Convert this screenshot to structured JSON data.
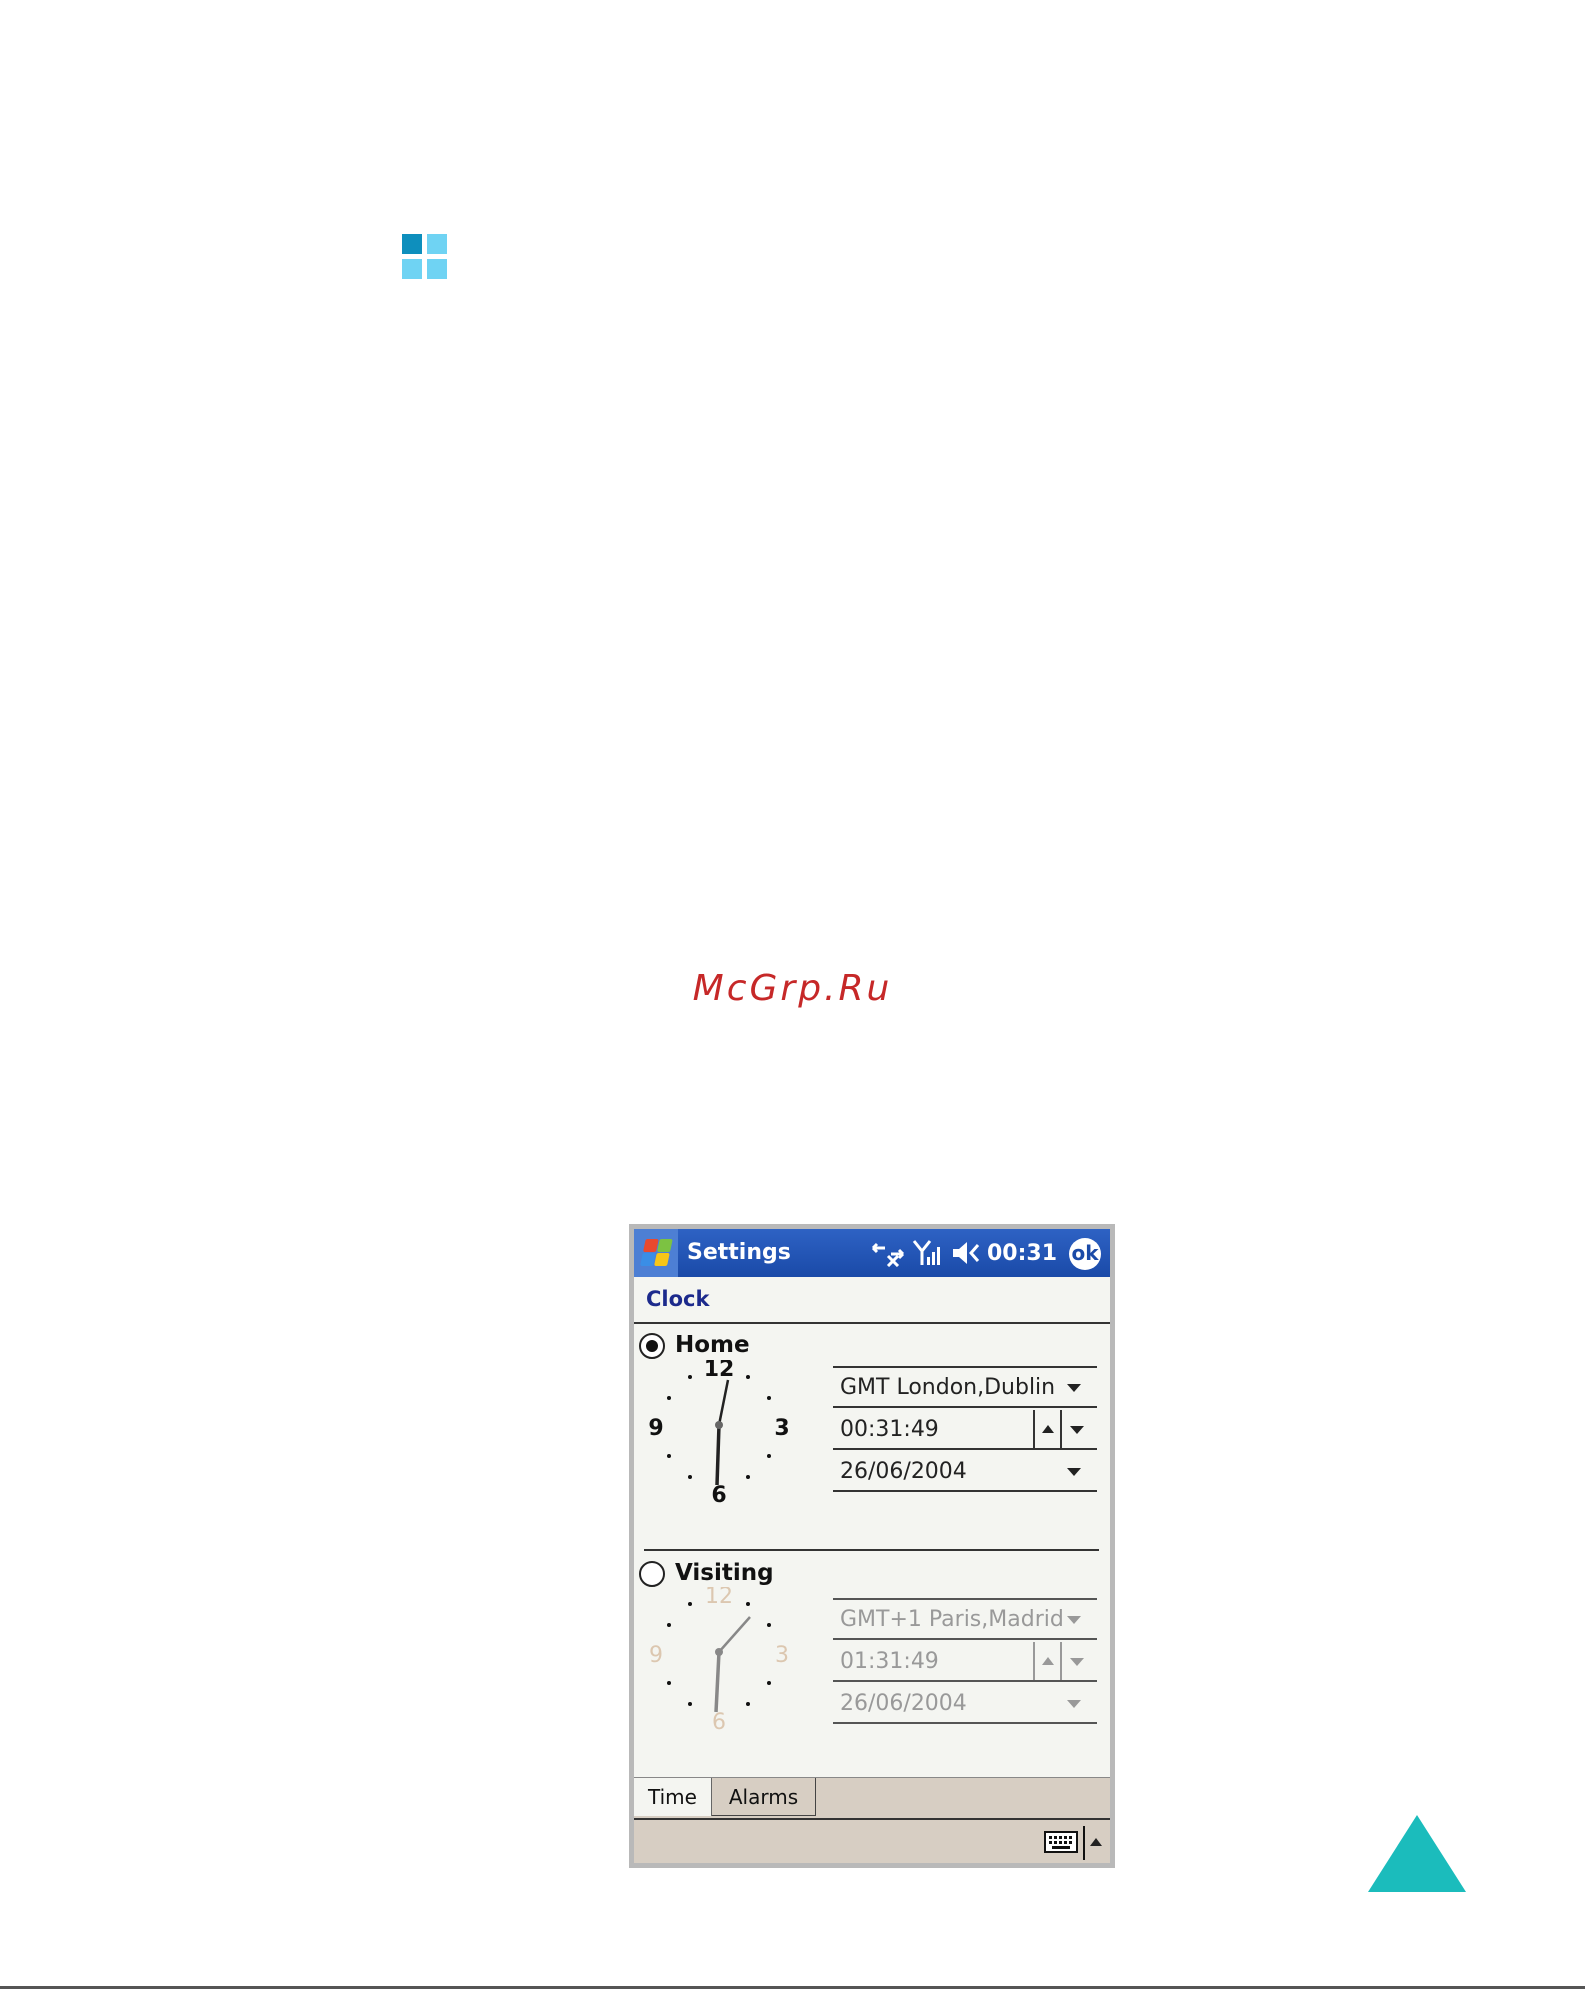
{
  "page": {
    "watermark": "McGrp.Ru",
    "logo_colors": [
      "#0e8fbd",
      "#6fd3f3",
      "#6fd3f3",
      "#6fd3f3"
    ],
    "nav_triangle_color": "#1bbcbc",
    "nav_triangle_icon": "up-triangle-icon"
  },
  "titlebar": {
    "start_icon": "windows-flag-icon",
    "title": "Settings",
    "tray_icons": [
      "connectivity-icon",
      "signal-strength-icon",
      "speaker-muted-icon"
    ],
    "time": "00:31",
    "ok_label": "ok",
    "color": "#1a4aa8"
  },
  "clock": {
    "section_title": "Clock",
    "home": {
      "label": "Home",
      "selected": true,
      "timezone": "GMT London,Dublin",
      "time": "00:31:49",
      "date": "26/06/2004",
      "dial_numbers": [
        "12",
        "3",
        "6",
        "9"
      ]
    },
    "visiting": {
      "label": "Visiting",
      "selected": false,
      "timezone": "GMT+1 Paris,Madrid",
      "time": "01:31:49",
      "date": "26/06/2004",
      "dial_numbers": [
        "12",
        "3",
        "6",
        "9"
      ]
    }
  },
  "tabs": [
    {
      "label": "Time",
      "active": true
    },
    {
      "label": "Alarms",
      "active": false
    }
  ],
  "cmdbar": {
    "keyboard_icon": "keyboard-icon",
    "sip_arrow_icon": "sip-up-arrow-icon"
  }
}
